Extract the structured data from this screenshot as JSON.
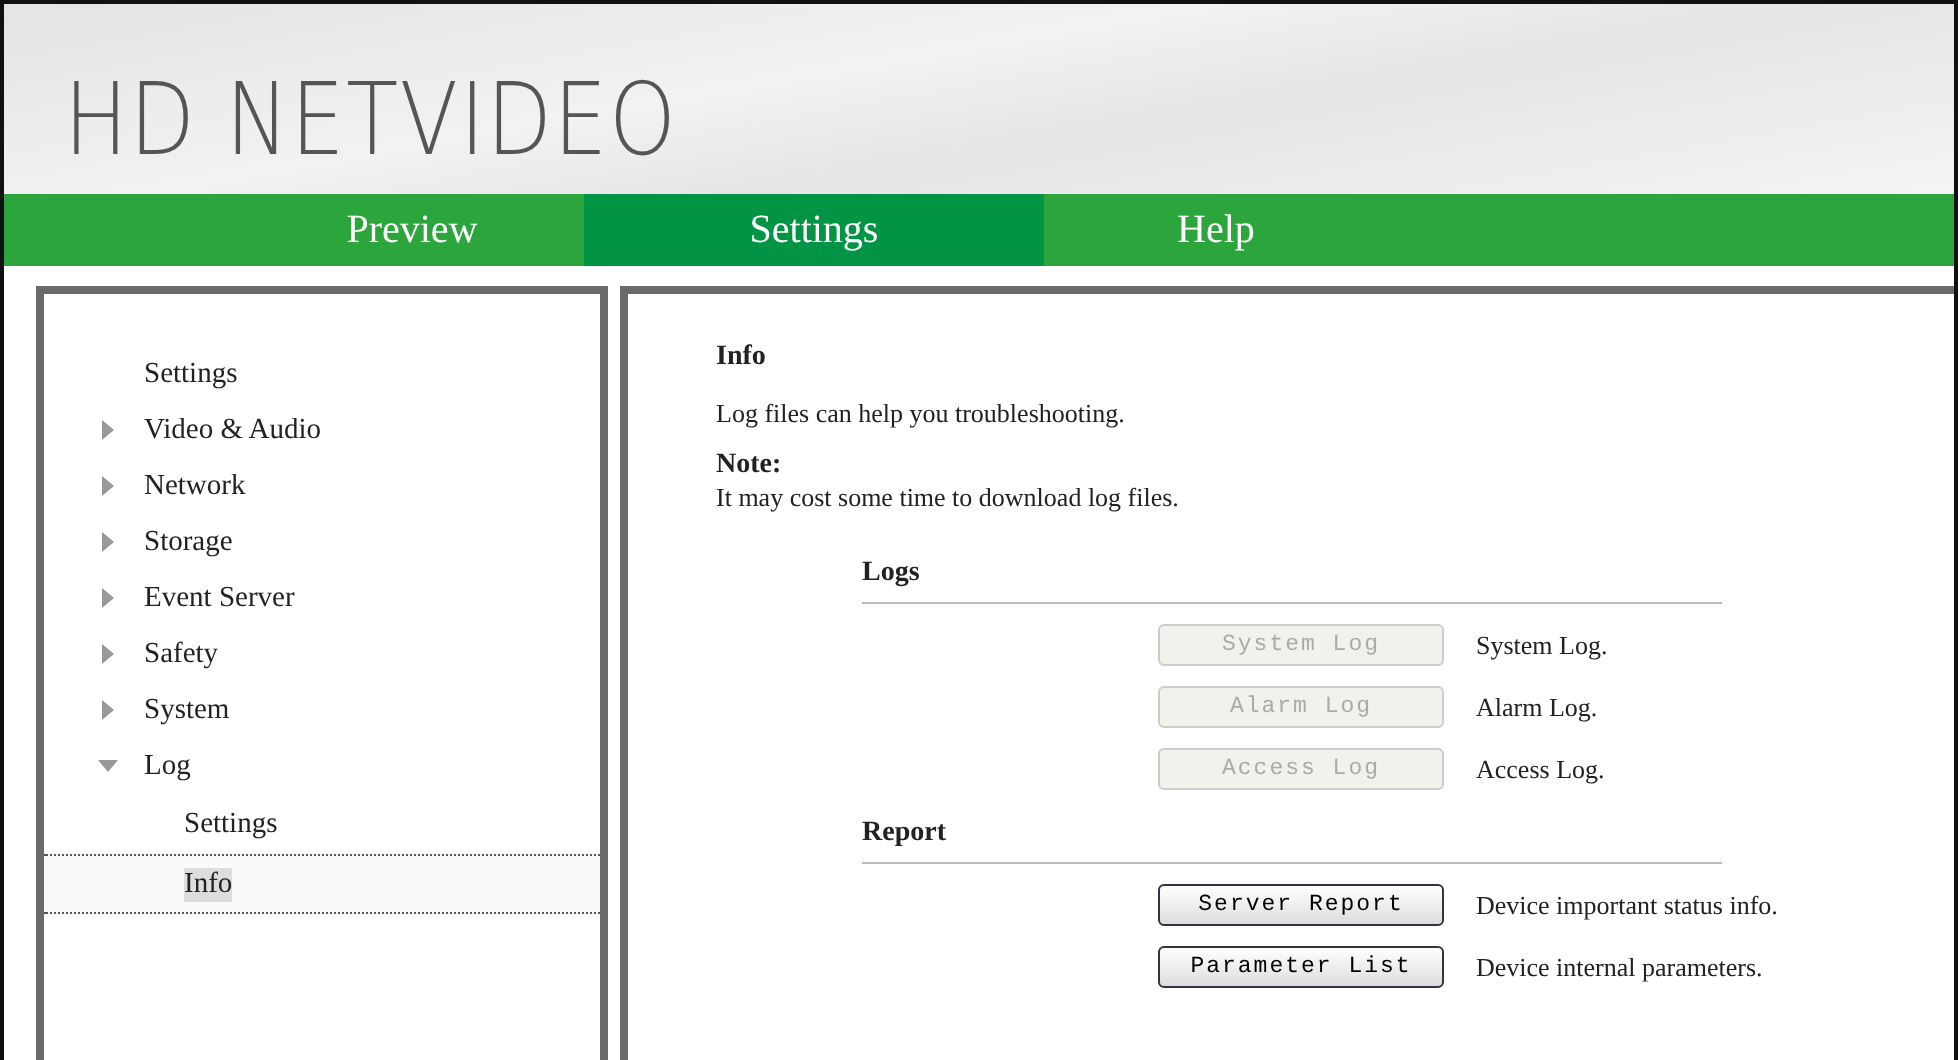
{
  "logo": {
    "text": "HD NETVIDEO"
  },
  "nav": [
    {
      "label": "Preview",
      "selected": false
    },
    {
      "label": "Settings",
      "selected": true
    },
    {
      "label": "Help",
      "selected": false
    }
  ],
  "sidebar": {
    "items": [
      {
        "label": "Settings",
        "kind": "heading"
      },
      {
        "label": "Video & Audio",
        "kind": "group",
        "expanded": false
      },
      {
        "label": "Network",
        "kind": "group",
        "expanded": false
      },
      {
        "label": "Storage",
        "kind": "group",
        "expanded": false
      },
      {
        "label": "Event Server",
        "kind": "group",
        "expanded": false
      },
      {
        "label": "Safety",
        "kind": "group",
        "expanded": false
      },
      {
        "label": "System",
        "kind": "group",
        "expanded": false
      },
      {
        "label": "Log",
        "kind": "group",
        "expanded": true,
        "children": [
          {
            "label": "Settings",
            "selected": false
          },
          {
            "label": "Info",
            "selected": true
          }
        ]
      }
    ]
  },
  "content": {
    "title": "Info",
    "description": "Log files can help you troubleshooting.",
    "note_label": "Note:",
    "note": "It may cost some time to download log files.",
    "sections": [
      {
        "title": "Logs",
        "rows": [
          {
            "button": "System Log",
            "disabled": true,
            "description": "System Log."
          },
          {
            "button": "Alarm Log",
            "disabled": true,
            "description": "Alarm Log."
          },
          {
            "button": "Access Log",
            "disabled": true,
            "description": "Access Log."
          }
        ]
      },
      {
        "title": "Report",
        "rows": [
          {
            "button": "Server Report",
            "disabled": false,
            "description": "Device important status info."
          },
          {
            "button": "Parameter List",
            "disabled": false,
            "description": "Device internal parameters."
          }
        ]
      }
    ]
  }
}
